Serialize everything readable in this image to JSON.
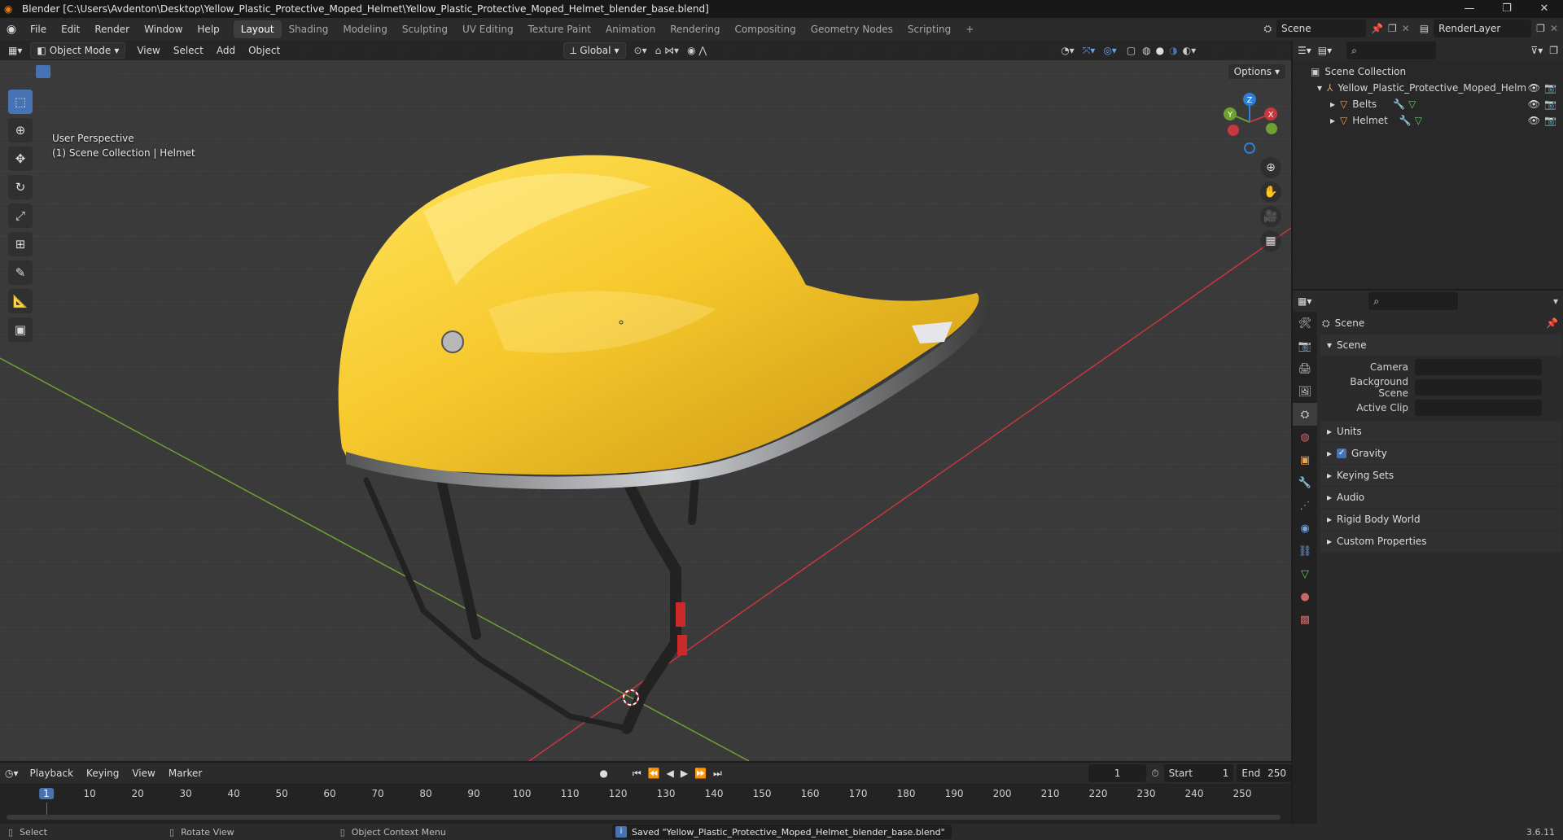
{
  "titlebar": {
    "title": "Blender [C:\\Users\\Avdenton\\Desktop\\Yellow_Plastic_Protective_Moped_Helmet\\Yellow_Plastic_Protective_Moped_Helmet_blender_base.blend]",
    "controls": [
      "minimize",
      "restore",
      "close"
    ]
  },
  "menu": [
    "File",
    "Edit",
    "Render",
    "Window",
    "Help"
  ],
  "workspaces": [
    "Layout",
    "Shading",
    "Modeling",
    "Sculpting",
    "UV Editing",
    "Texture Paint",
    "Animation",
    "Rendering",
    "Compositing",
    "Geometry Nodes",
    "Scripting"
  ],
  "active_workspace": "Layout",
  "add_workspace": "+",
  "scene_field": "Scene",
  "renderlayer_field": "RenderLayer",
  "viewport": {
    "mode": "Object Mode",
    "menus": [
      "View",
      "Select",
      "Add",
      "Object"
    ],
    "orientation": "Global",
    "options_label": "Options",
    "overlay_line1": "User Perspective",
    "overlay_line2": "(1) Scene Collection | Helmet",
    "gizmo": {
      "x": "X",
      "y": "Y",
      "z": "Z"
    }
  },
  "outliner": {
    "root": "Scene Collection",
    "items": [
      {
        "label": "Yellow_Plastic_Protective_Moped_Helm",
        "type": "collection"
      },
      {
        "label": "Belts",
        "type": "mesh"
      },
      {
        "label": "Helmet",
        "type": "mesh"
      }
    ]
  },
  "properties": {
    "header": "Scene",
    "sections": [
      {
        "label": "Scene",
        "expanded": true
      },
      {
        "label": "Units"
      },
      {
        "label": "Gravity",
        "checked": true
      },
      {
        "label": "Keying Sets"
      },
      {
        "label": "Audio"
      },
      {
        "label": "Rigid Body World"
      },
      {
        "label": "Custom Properties"
      }
    ],
    "fields": {
      "camera": "Camera",
      "background_scene": "Background Scene",
      "active_clip": "Active Clip"
    }
  },
  "timeline": {
    "menus": [
      "Playback",
      "Keying",
      "View",
      "Marker"
    ],
    "current_frame": "1",
    "start_label": "Start",
    "start": "1",
    "end_label": "End",
    "end": "250",
    "ruler": [
      "1",
      "10",
      "20",
      "30",
      "40",
      "50",
      "60",
      "70",
      "80",
      "90",
      "100",
      "110",
      "120",
      "130",
      "140",
      "150",
      "160",
      "170",
      "180",
      "190",
      "200",
      "210",
      "220",
      "230",
      "240",
      "250"
    ]
  },
  "status": {
    "select": "Select",
    "rotate": "Rotate View",
    "context": "Object Context Menu",
    "message": "Saved \"Yellow_Plastic_Protective_Moped_Helmet_blender_base.blend\"",
    "version": "3.6.11"
  },
  "colors": {
    "accent": "#4772b3",
    "helmet": "#f2c21f",
    "x_axis": "#c8373f",
    "y_axis": "#6fa032"
  }
}
